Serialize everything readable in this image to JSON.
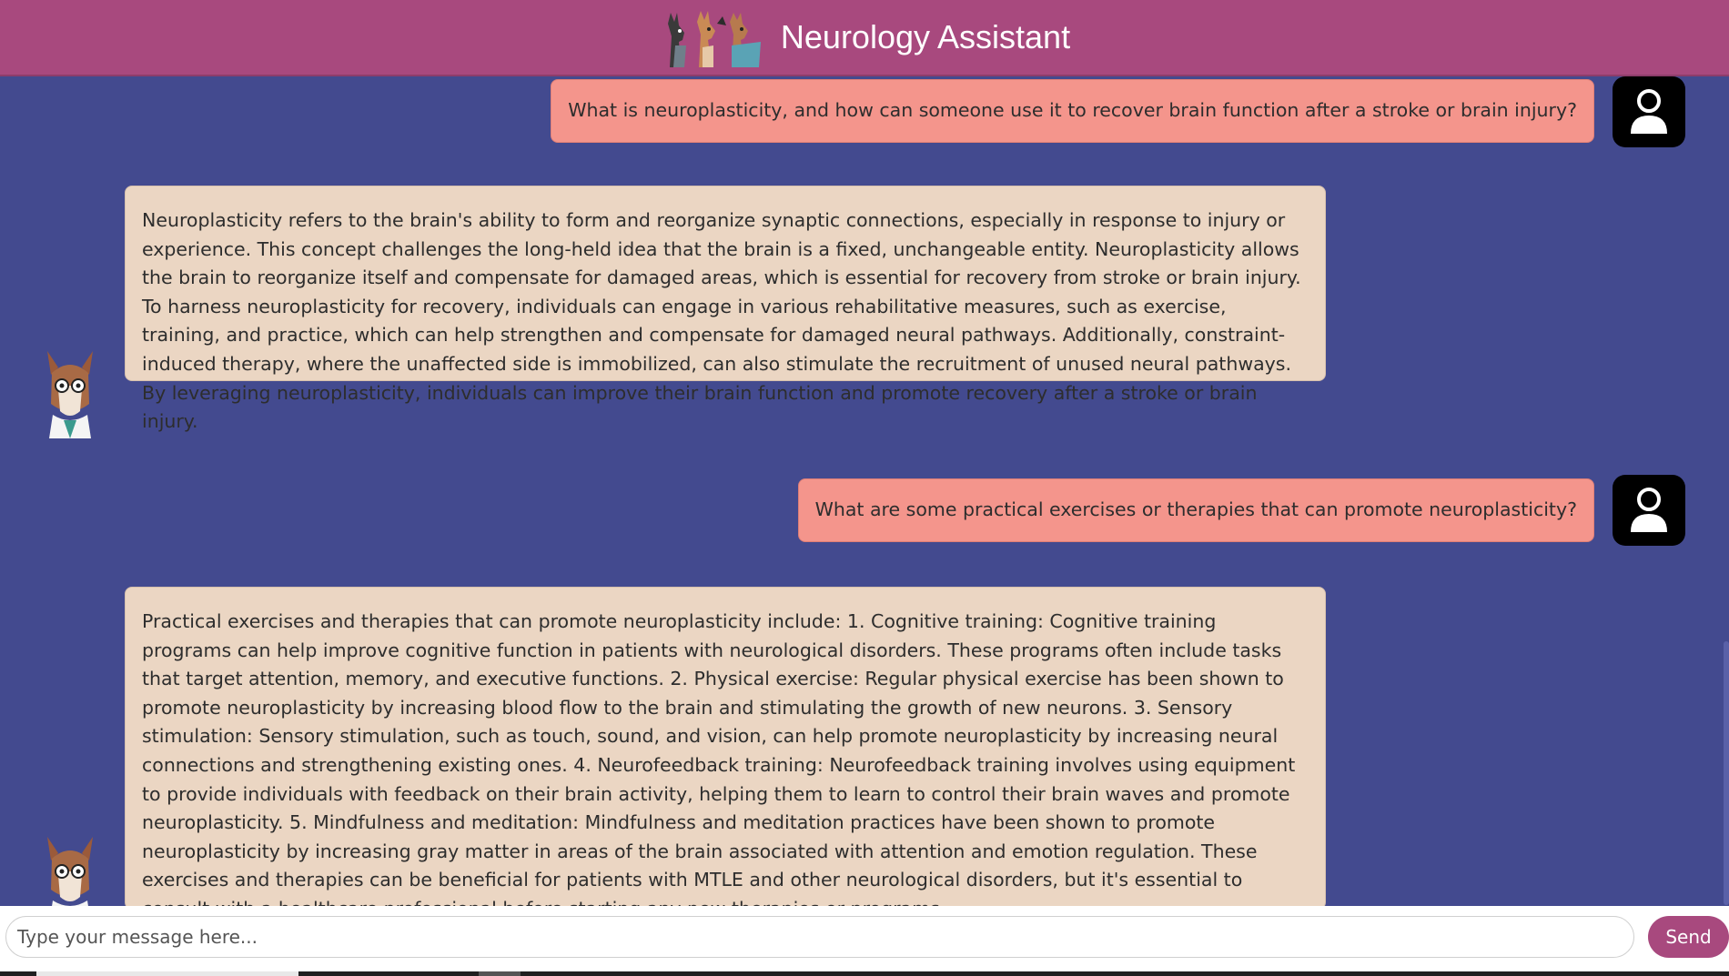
{
  "header": {
    "title": "Neurology Assistant",
    "logo_icon": "llama-trio-logo-icon"
  },
  "colors": {
    "header_bg": "#a8497e",
    "chat_bg": "#434a8f",
    "user_bubble": "#f4958c",
    "bot_bubble": "#ebd6c3",
    "send_button": "#a8497e"
  },
  "messages": [
    {
      "role": "user",
      "avatar_icon": "user-silhouette-icon",
      "text": "What is neuroplasticity, and how can someone use it to recover brain function after a stroke or brain injury?"
    },
    {
      "role": "assistant",
      "avatar_icon": "llama-doctor-avatar-icon",
      "text": "Neuroplasticity refers to the brain's ability to form and reorganize synaptic connections, especially in response to injury or experience. This concept challenges the long-held idea that the brain is a fixed, unchangeable entity. Neuroplasticity allows the brain to reorganize itself and compensate for damaged areas, which is essential for recovery from stroke or brain injury. To harness neuroplasticity for recovery, individuals can engage in various rehabilitative measures, such as exercise, training, and practice, which can help strengthen and compensate for damaged neural pathways. Additionally, constraint-induced therapy, where the unaffected side is immobilized, can also stimulate the recruitment of unused neural pathways. By leveraging neuroplasticity, individuals can improve their brain function and promote recovery after a stroke or brain injury."
    },
    {
      "role": "user",
      "avatar_icon": "user-silhouette-icon",
      "text": "What are some practical exercises or therapies that can promote neuroplasticity?"
    },
    {
      "role": "assistant",
      "avatar_icon": "llama-doctor-avatar-icon",
      "text": "Practical exercises and therapies that can promote neuroplasticity include: 1. Cognitive training: Cognitive training programs can help improve cognitive function in patients with neurological disorders. These programs often include tasks that target attention, memory, and executive functions. 2. Physical exercise: Regular physical exercise has been shown to promote neuroplasticity by increasing blood flow to the brain and stimulating the growth of new neurons. 3. Sensory stimulation: Sensory stimulation, such as touch, sound, and vision, can help promote neuroplasticity by increasing neural connections and strengthening existing ones. 4. Neurofeedback training: Neurofeedback training involves using equipment to provide individuals with feedback on their brain activity, helping them to learn to control their brain waves and promote neuroplasticity. 5. Mindfulness and meditation: Mindfulness and meditation practices have been shown to promote neuroplasticity by increasing gray matter in areas of the brain associated with attention and emotion regulation. These exercises and therapies can be beneficial for patients with MTLE and other neurological disorders, but it's essential to consult with a healthcare professional before starting any new therapies or programs."
    }
  ],
  "composer": {
    "placeholder": "Type your message here...",
    "value": "",
    "send_label": "Send"
  }
}
